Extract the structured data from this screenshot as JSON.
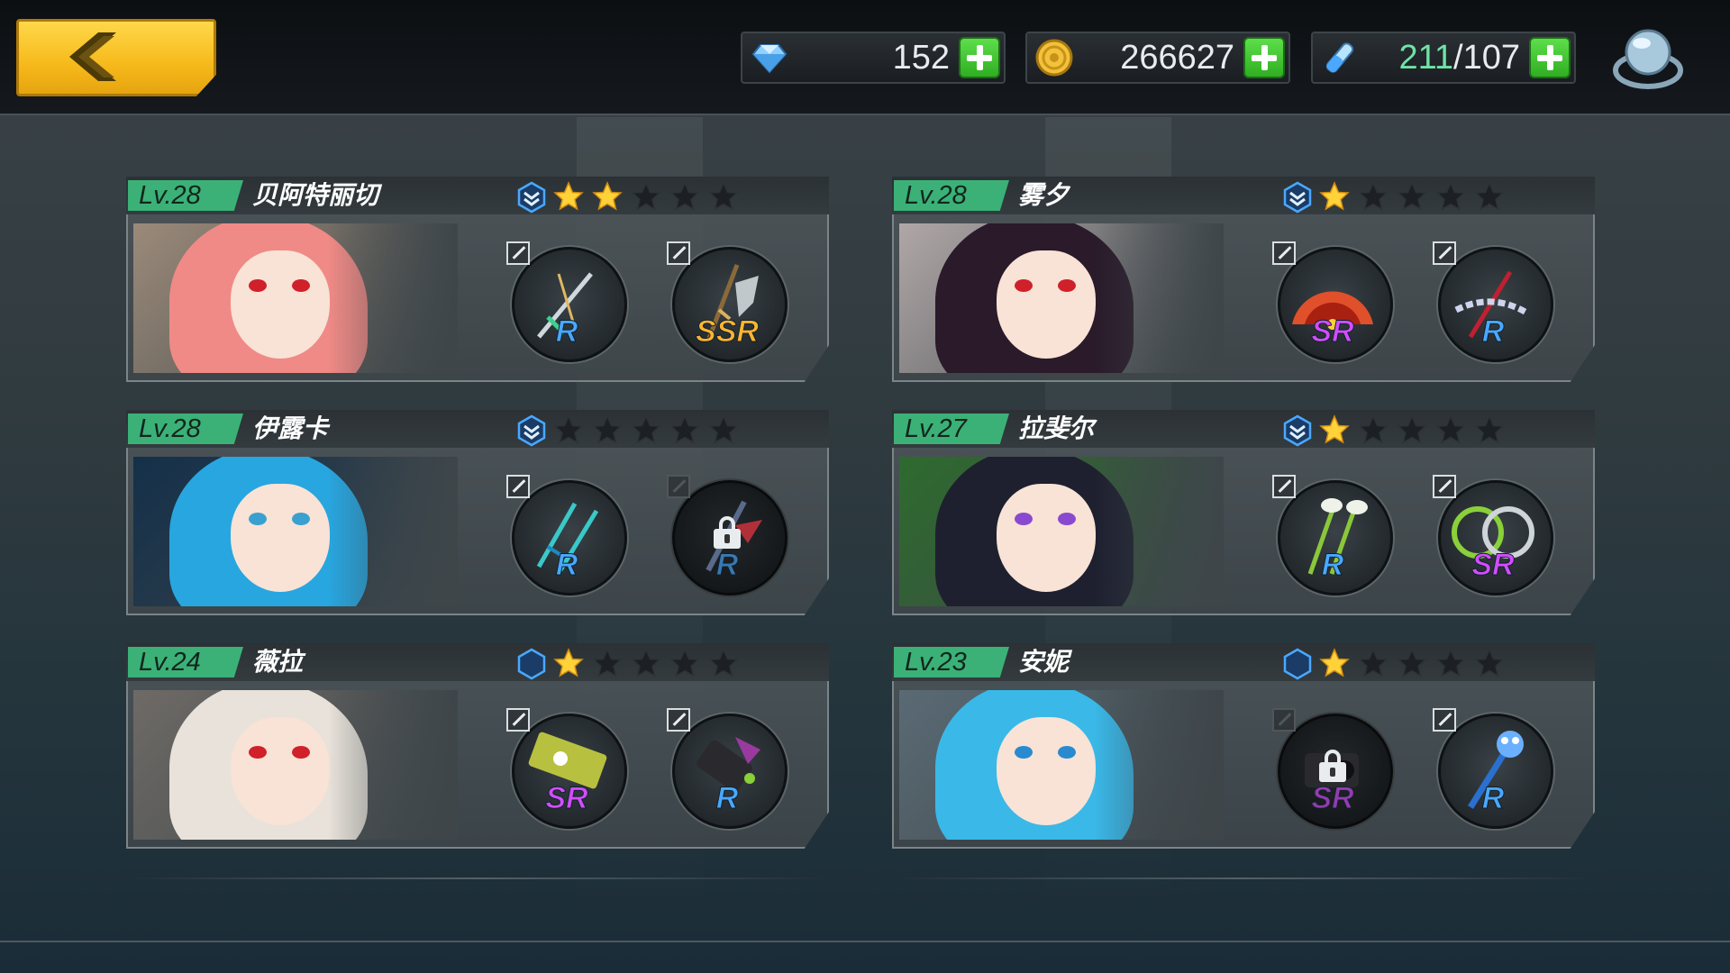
{
  "header": {
    "back_icon": "chevron-left-icon",
    "resources": [
      {
        "icon": "diamond-icon",
        "value": "152"
      },
      {
        "icon": "gold-coin-icon",
        "value": "266627"
      },
      {
        "icon": "stamina-potion-icon",
        "current": "211",
        "sep": "/",
        "max": "107"
      }
    ],
    "orb_icon": "crystal-orb-icon"
  },
  "colors": {
    "accent_green": "#3bb178",
    "star_gold": "#ffd23a",
    "rarity_R": "#4aa8ff",
    "rarity_SR": "#d24dff",
    "rarity_SSR": "#ffb52e"
  },
  "characters": [
    {
      "level": "Lv.28",
      "name": "贝阿特丽切",
      "rank": "shield-chevron-icon",
      "stars": 2,
      "max_stars": 5,
      "portrait_colors": {
        "hair": "#f08a86",
        "eyes": "#d0202a",
        "bg": "#9b8a79"
      },
      "weapons": [
        {
          "rarity": "R",
          "icon": "sword-icon",
          "locked": false
        },
        {
          "rarity": "SSR",
          "icon": "katana-icon",
          "locked": false
        }
      ]
    },
    {
      "level": "Lv.28",
      "name": "雾夕",
      "rank": "shield-chevron-icon",
      "stars": 1,
      "max_stars": 5,
      "portrait_colors": {
        "hair": "#2a1a2a",
        "eyes": "#d0202a",
        "bg": "#b0a7a7"
      },
      "weapons": [
        {
          "rarity": "SR",
          "icon": "fan-icon",
          "locked": false
        },
        {
          "rarity": "R",
          "icon": "staff-icon",
          "locked": false
        }
      ]
    },
    {
      "level": "Lv.28",
      "name": "伊露卡",
      "rank": "shield-chevron-icon",
      "stars": 0,
      "max_stars": 5,
      "portrait_colors": {
        "hair": "#28a6e0",
        "eyes": "#3aa0d0",
        "bg": "#14304a"
      },
      "weapons": [
        {
          "rarity": "R",
          "icon": "dual-daggers-icon",
          "locked": false
        },
        {
          "rarity": "R",
          "icon": "dark-sword-icon",
          "locked": true
        }
      ]
    },
    {
      "level": "Lv.27",
      "name": "拉斐尔",
      "rank": "shield-chevron-icon",
      "stars": 1,
      "max_stars": 5,
      "portrait_colors": {
        "hair": "#1e2030",
        "eyes": "#8a4ad0",
        "bg": "#2e6a2e"
      },
      "weapons": [
        {
          "rarity": "R",
          "icon": "feather-spears-icon",
          "locked": false
        },
        {
          "rarity": "SR",
          "icon": "chakram-icon",
          "locked": false
        }
      ]
    },
    {
      "level": "Lv.24",
      "name": "薇拉",
      "rank": "hexagon-icon",
      "stars": 1,
      "max_stars": 5,
      "portrait_colors": {
        "hair": "#e8e2da",
        "eyes": "#d0202a",
        "bg": "#6e6a66"
      },
      "weapons": [
        {
          "rarity": "SR",
          "icon": "death-cannon-icon",
          "locked": false
        },
        {
          "rarity": "R",
          "icon": "blaster-icon",
          "locked": false
        }
      ]
    },
    {
      "level": "Lv.23",
      "name": "安妮",
      "rank": "hexagon-icon",
      "stars": 1,
      "max_stars": 5,
      "portrait_colors": {
        "hair": "#3ab8e8",
        "eyes": "#2a8ad0",
        "bg": "#5a6a74"
      },
      "weapons": [
        {
          "rarity": "SR",
          "icon": "camera-icon",
          "locked": true
        },
        {
          "rarity": "R",
          "icon": "paw-wand-icon",
          "locked": false
        }
      ]
    }
  ]
}
